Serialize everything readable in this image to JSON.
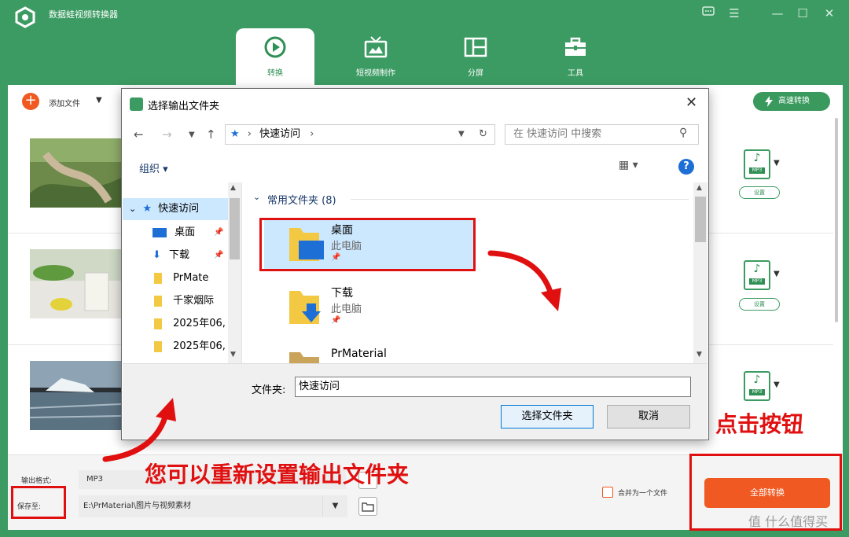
{
  "app": {
    "title": "数据蛙视频转换器",
    "window_controls": [
      "feedback-icon",
      "menu-icon",
      "minimize-icon",
      "maximize-icon",
      "close-icon"
    ]
  },
  "tabs": [
    {
      "label": "转换",
      "icon": "convert-icon",
      "active": true
    },
    {
      "label": "短视频制作",
      "icon": "tv-icon",
      "active": false
    },
    {
      "label": "分屏",
      "icon": "split-screen-icon",
      "active": false
    },
    {
      "label": "工具",
      "icon": "toolbox-icon",
      "active": false
    }
  ],
  "toolbar": {
    "add_file": "添加文件",
    "high_speed": "高速转换"
  },
  "files": [
    {
      "format": "MP3",
      "settings": "设置"
    },
    {
      "format": "MP3",
      "settings": "设置"
    },
    {
      "format": "MP3",
      "settings": "设置"
    }
  ],
  "bottom": {
    "output_format_label": "输出格式:",
    "output_format_value": "MP3",
    "save_to_label": "保存至:",
    "save_to_value": "E:\\PrMaterial\\图片与视频素材",
    "merge_label": "合并为一个文件",
    "convert_all": "全部转换"
  },
  "dialog": {
    "title": "选择输出文件夹",
    "address": "快速访问",
    "search_placeholder": "在 快速访问 中搜索",
    "organize": "组织",
    "tree": [
      {
        "label": "快速访问",
        "selected": true
      },
      {
        "label": "桌面"
      },
      {
        "label": "下载"
      },
      {
        "label": "PrMate"
      },
      {
        "label": "千家烟际"
      },
      {
        "label": "2025年06,"
      },
      {
        "label": "2025年06,"
      }
    ],
    "group_header": "常用文件夹 (8)",
    "items": [
      {
        "name": "桌面",
        "sub": "此电脑"
      },
      {
        "name": "下载",
        "sub": "此电脑"
      },
      {
        "name": "PrMaterial",
        "sub": ""
      }
    ],
    "folder_label": "文件夹:",
    "folder_value": "快速访问",
    "select_button": "选择文件夹",
    "cancel_button": "取消"
  },
  "annotations": {
    "click_button": "点击按钮",
    "reset_folder": "您可以重新设置输出文件夹"
  },
  "watermark": "值 什么值得买"
}
